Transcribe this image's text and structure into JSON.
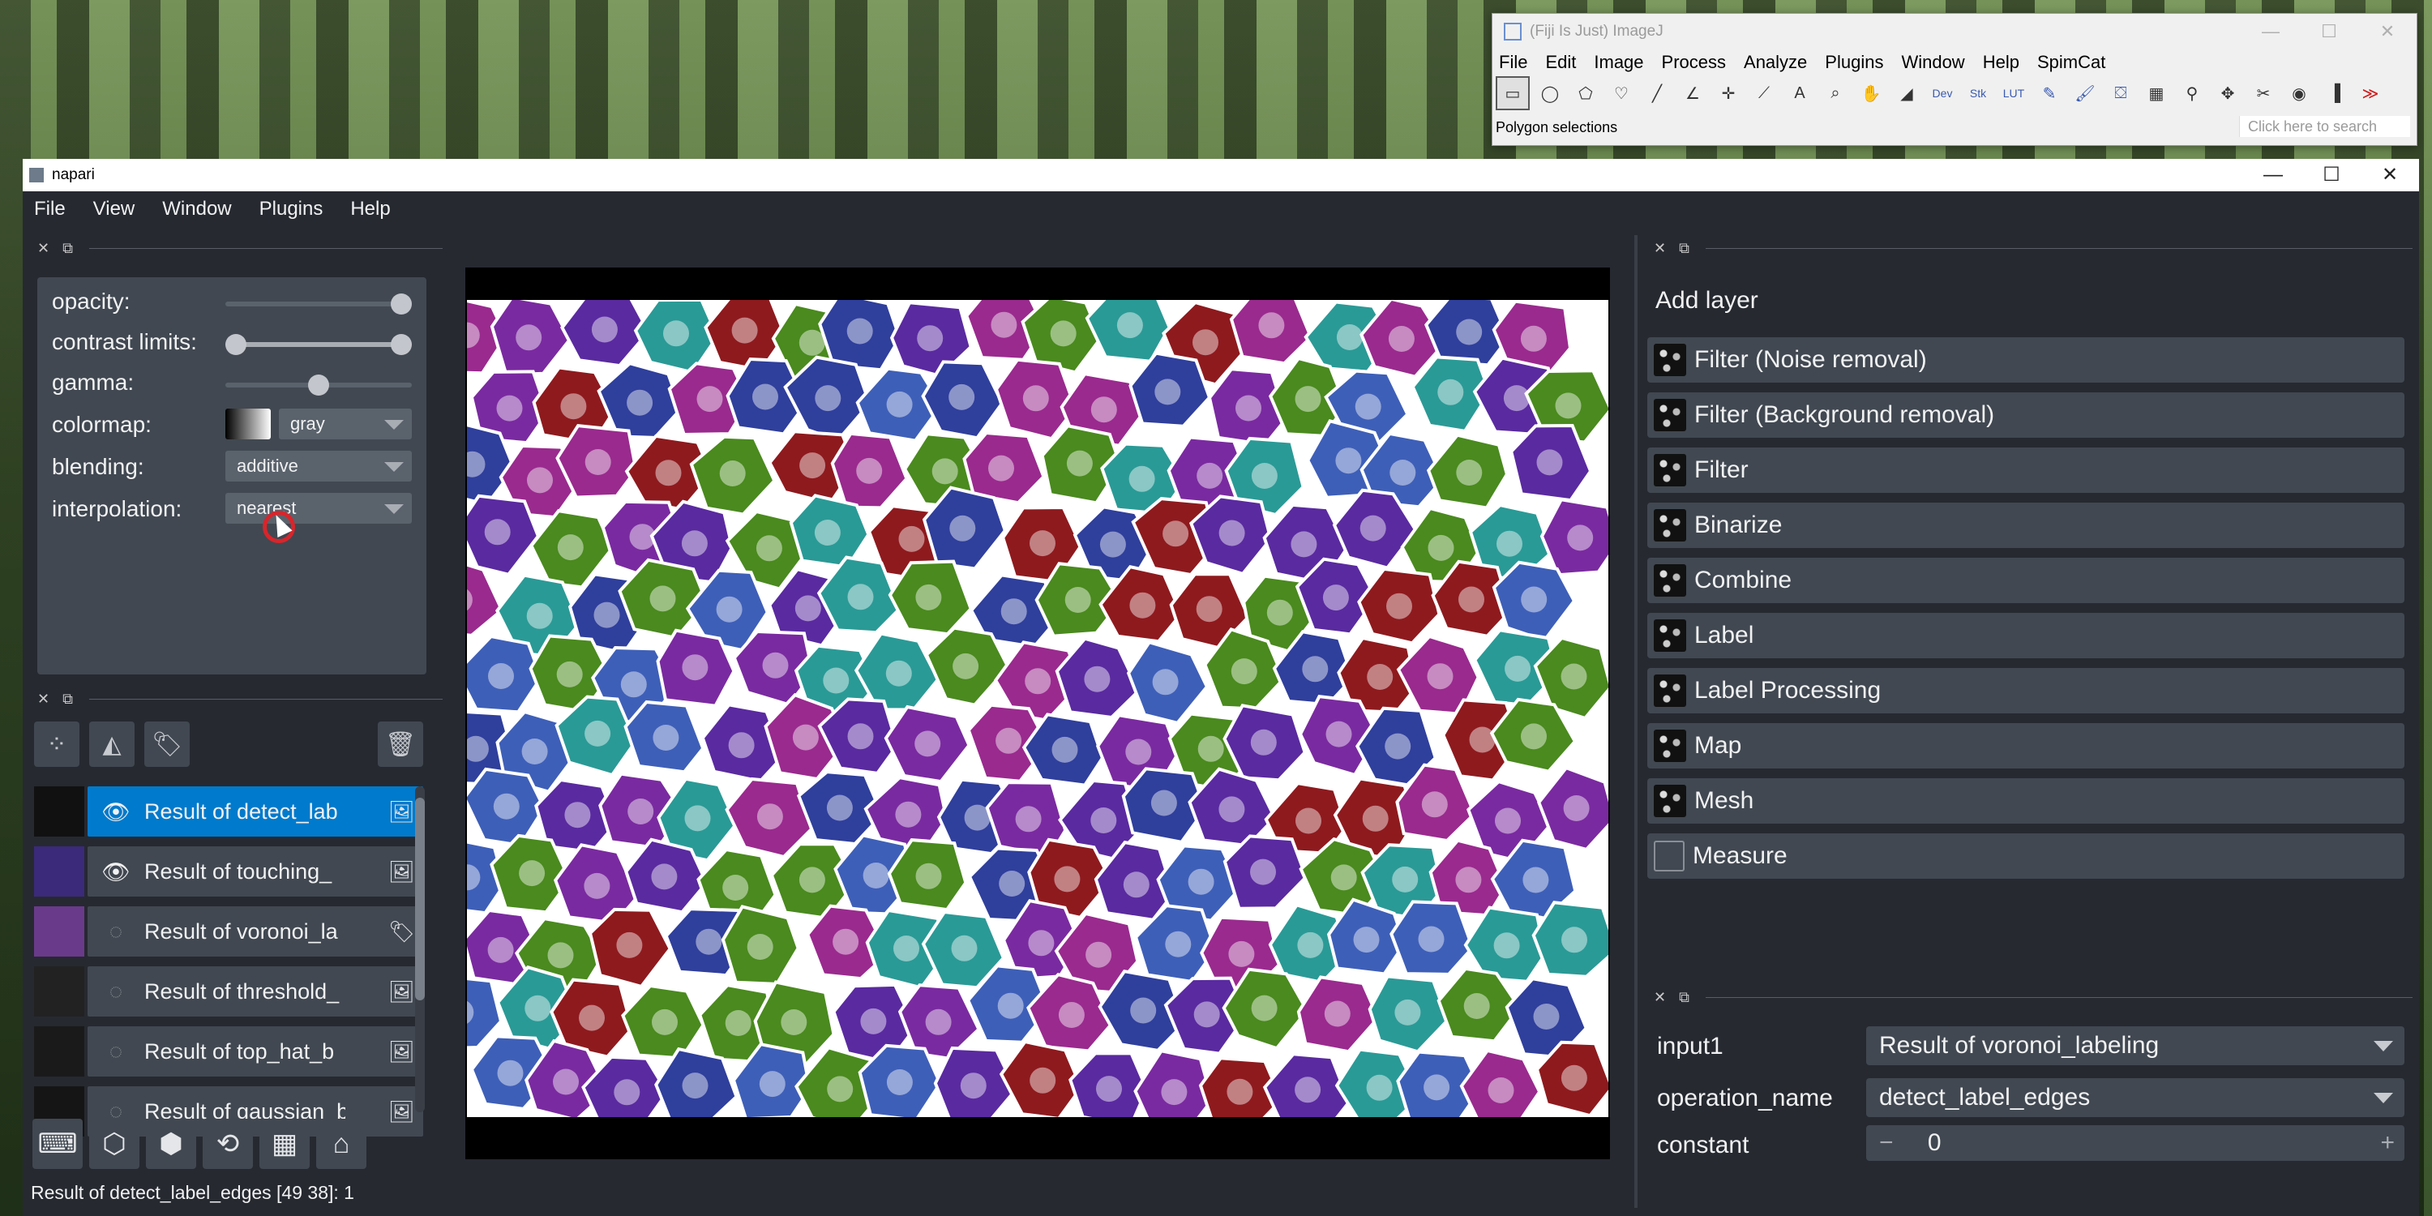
{
  "imagej": {
    "title": "(Fiji Is Just) ImageJ",
    "menu": [
      "File",
      "Edit",
      "Image",
      "Process",
      "Analyze",
      "Plugins",
      "Window",
      "Help",
      "SpimCat"
    ],
    "status": "Polygon selections",
    "search_placeholder": "Click here to search",
    "tool_labels": [
      "Dev",
      "Stk",
      "LUT"
    ],
    "window_controls": [
      "—",
      "☐",
      "✕"
    ]
  },
  "napari": {
    "title": "napari",
    "window_controls": [
      "—",
      "☐",
      "✕"
    ],
    "menu": [
      "File",
      "View",
      "Window",
      "Plugins",
      "Help"
    ],
    "layer_controls": {
      "opacity_label": "opacity:",
      "opacity": 1.0,
      "contrast_label": "contrast limits:",
      "contrast_limits": [
        0.0,
        1.0
      ],
      "gamma_label": "gamma:",
      "gamma": 0.5,
      "colormap_label": "colormap:",
      "colormap": "gray",
      "blending_label": "blending:",
      "blending": "additive",
      "interpolation_label": "interpolation:",
      "interpolation": "nearest"
    },
    "layers": [
      {
        "name": "Result of detect_lab",
        "visible": true,
        "selected": true,
        "kind": "image"
      },
      {
        "name": "Result of touching_",
        "visible": true,
        "selected": false,
        "kind": "image"
      },
      {
        "name": "Result of voronoi_la",
        "visible": false,
        "selected": false,
        "kind": "labels"
      },
      {
        "name": "Result of threshold_",
        "visible": false,
        "selected": false,
        "kind": "image"
      },
      {
        "name": "Result of top_hat_b",
        "visible": false,
        "selected": false,
        "kind": "image"
      },
      {
        "name": "Result of gaussian_b",
        "visible": false,
        "selected": false,
        "kind": "image"
      }
    ],
    "status": "Result of detect_label_edges [49 38]: 1",
    "add_layer": {
      "title": "Add layer",
      "buttons": [
        "Filter (Noise removal)",
        "Filter (Background removal)",
        "Filter",
        "Binarize",
        "Combine",
        "Label",
        "Label Processing",
        "Map",
        "Mesh",
        "Measure"
      ]
    },
    "params": {
      "input1_label": "input1",
      "input1_value": "Result of voronoi_labeling",
      "operation_label": "operation_name",
      "operation_value": "detect_label_edges",
      "constant_label": "constant",
      "constant_value": "0",
      "minus": "−",
      "plus": "+"
    }
  },
  "colors": {
    "accent": "#007acc",
    "panel": "#414851",
    "background": "#262930",
    "cell_palette": [
      "#2f3f9c",
      "#5a2aa0",
      "#3e5fb8",
      "#9a2a8e",
      "#7a2aa0",
      "#2a9a96",
      "#8e1a1e",
      "#4a8a1e"
    ]
  }
}
